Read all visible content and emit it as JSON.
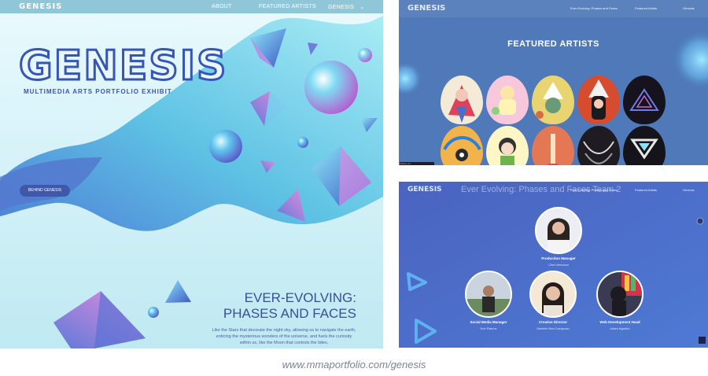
{
  "main": {
    "brand": "GENESIS",
    "nav": [
      {
        "label": "ABOUT"
      },
      {
        "label": "FEATURED ARTISTS"
      },
      {
        "label": "GENESIS"
      }
    ],
    "logo": "GENESIS",
    "subtitle": "MULTIMEDIA ARTS PORTFOLIO EXHIBIT",
    "cta_label": "BEHIND GENESIS",
    "hero_title_line1": "EVER-EVOLVING:",
    "hero_title_line2": "PHASES AND FACES",
    "hero_body": "Like the Stars that decorate the night sky, allowing us to navigate the earth, enticing the mysterious wonders of the universe, and fuels the curiosity within us, like the Moon that controls the tides,"
  },
  "artists": {
    "brand": "GENESIS",
    "nav": [
      {
        "label": "Ever Evolving: Phases and Faces"
      },
      {
        "label": "Featured Artists"
      },
      {
        "label": "Genesis"
      }
    ],
    "title": "FEATURED ARTISTS",
    "status_text": "Waiting for maps.mmaportfolio.com..."
  },
  "team": {
    "brand": "GENESIS",
    "marquee": "Ever Evolving: Phases and Faces Team 2",
    "nav": [
      {
        "label": "Ever Evolving: Phases and Faces"
      },
      {
        "label": "Featured Artists"
      },
      {
        "label": "Genesis"
      }
    ],
    "members": [
      {
        "role": "Production Manager",
        "name": "Chel Mendoza"
      },
      {
        "role": "Social Media Manager",
        "name": "Kurt Ramos"
      },
      {
        "role": "Creative Director",
        "name": "Marielle Bea Cacayuan"
      },
      {
        "role": "Web Development Head",
        "name": "Adam Agarido"
      }
    ]
  },
  "caption": "www.mmaportfolio.com/genesis",
  "colors": {
    "accent": "#3f58a8",
    "sky": "#c9eef5",
    "artists_bg": "#4d77b5",
    "team_bg": "#4a6fc8"
  }
}
